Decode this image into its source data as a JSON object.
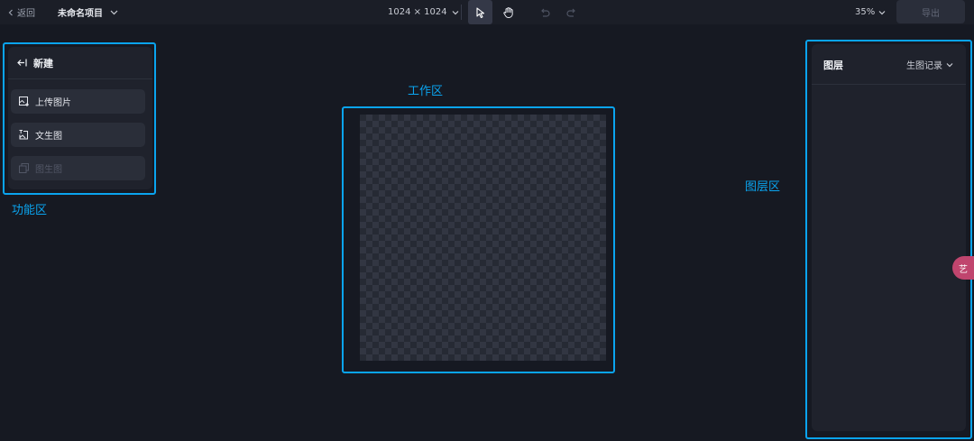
{
  "topbar": {
    "back_label": "返回",
    "project_name": "未命名项目",
    "canvas_size": "1024 × 1024",
    "zoom": "35%",
    "export_label": "导出"
  },
  "left_panel": {
    "title": "新建",
    "buttons": [
      {
        "label": "上传图片",
        "icon": "upload-image-icon",
        "enabled": true
      },
      {
        "label": "文生图",
        "icon": "text-to-image-icon",
        "enabled": true
      },
      {
        "label": "图生图",
        "icon": "image-to-image-icon",
        "enabled": false
      }
    ]
  },
  "right_panel": {
    "title": "图层",
    "history_label": "生图记录"
  },
  "annotations": {
    "function_area": "功能区",
    "work_area": "工作区",
    "layer_area": "图层区"
  },
  "float_badge": "艺",
  "colors": {
    "annotation": "#0aa4ef",
    "background": "#161922",
    "panel": "#1f222c"
  }
}
